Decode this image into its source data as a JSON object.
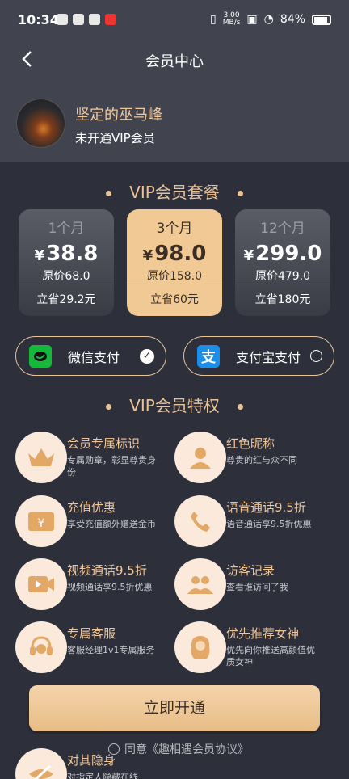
{
  "status_bar": {
    "time": "10:34",
    "net_speed_top": "3.00",
    "net_speed_bottom": "MB/s",
    "battery": "84%"
  },
  "nav": {
    "title": "会员中心",
    "back_icon": "chevron-left-icon"
  },
  "user": {
    "name": "坚定的巫马峰",
    "status": "未开通VIP会员"
  },
  "packages": {
    "title": "VIP会员套餐",
    "plans": [
      {
        "name": "1个月",
        "currency": "¥",
        "price": "38.8",
        "original": "原价68.0",
        "save": "立省29.2元",
        "selected": false
      },
      {
        "name": "3个月",
        "currency": "¥",
        "price": "98.0",
        "original": "原价158.0",
        "save": "立省60元",
        "selected": true
      },
      {
        "name": "12个月",
        "currency": "¥",
        "price": "299.0",
        "original": "原价479.0",
        "save": "立省180元",
        "selected": false
      }
    ]
  },
  "payment": {
    "wechat": {
      "label": "微信支付",
      "selected": true
    },
    "alipay": {
      "label": "支付宝支付",
      "icon_char": "支",
      "selected": false
    }
  },
  "privileges": {
    "title": "VIP会员特权",
    "items": [
      {
        "title": "会员专属标识",
        "desc": "专属勋章，彰显尊贵身份",
        "icon": "crown-icon"
      },
      {
        "title": "红色昵称",
        "desc": "尊贵的红与众不同",
        "icon": "user-icon"
      },
      {
        "title": "充值优惠",
        "desc": "享受充值额外赠送金币",
        "icon": "wallet-icon"
      },
      {
        "title": "语音通话9.5折",
        "desc": "语音通话享9.5折优惠",
        "icon": "phone-icon"
      },
      {
        "title": "视频通话9.5折",
        "desc": "视频通话享9.5折优惠",
        "icon": "video-icon"
      },
      {
        "title": "访客记录",
        "desc": "查看谁访问了我",
        "icon": "visitors-icon"
      },
      {
        "title": "专属客服",
        "desc": "客服经理1v1专属服务",
        "icon": "headset-icon"
      },
      {
        "title": "优先推荐女神",
        "desc": "优先向你推送高颜值优质女神",
        "icon": "goddess-icon"
      },
      {
        "title": "对其隐身",
        "desc": "对指定人隐藏在线",
        "icon": "invisible-icon"
      }
    ]
  },
  "cta": {
    "label": "立即开通"
  },
  "agreement": {
    "text": "同意《趣相遇会员协议》"
  },
  "colors": {
    "background": "#2d2f3b",
    "header": "#41434f",
    "gold": "#e9c49a",
    "selected_plan": "#f0c995"
  }
}
